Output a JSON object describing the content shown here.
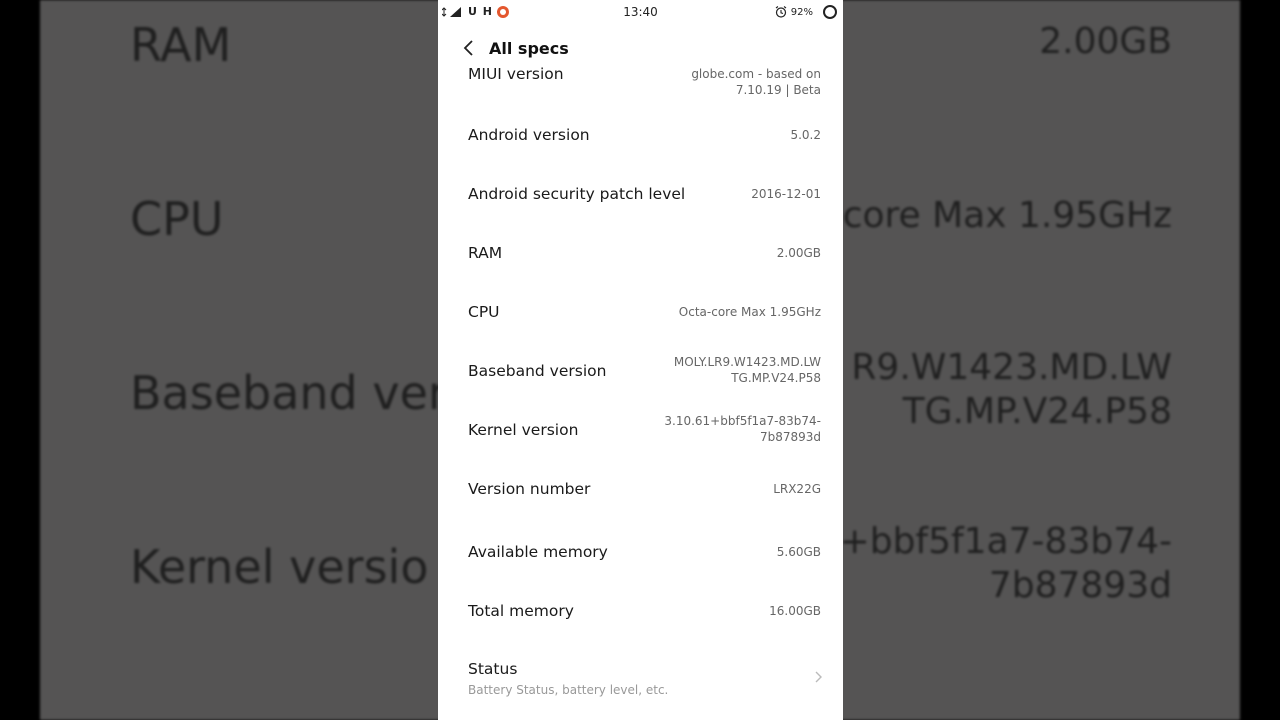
{
  "background": {
    "left_labels": [
      "RAM",
      "CPU",
      "Baseband ver",
      "Kernel versio"
    ],
    "right_values": [
      [
        "2.00GB"
      ],
      [
        "core Max 1.95GHz"
      ],
      [
        "R9.W1423.MD.LW",
        "TG.MP.V24.P58"
      ],
      [
        "+bbf5f1a7-83b74-",
        "7b87893d"
      ]
    ]
  },
  "statusbar": {
    "network": "U H",
    "time": "13:40",
    "battery": "92%"
  },
  "header": {
    "title": "All specs"
  },
  "rows": [
    {
      "label": "MIUI version",
      "value": [
        "globe.com - based on",
        "7.10.19 | Beta"
      ]
    },
    {
      "label": "Android version",
      "value": [
        "5.0.2"
      ]
    },
    {
      "label": "Android security patch level",
      "value": [
        "2016-12-01"
      ]
    },
    {
      "label": "RAM",
      "value": [
        "2.00GB"
      ]
    },
    {
      "label": "CPU",
      "value": [
        "Octa-core Max 1.95GHz"
      ]
    },
    {
      "label": "Baseband version",
      "value": [
        "MOLY.LR9.W1423.MD.LW",
        "TG.MP.V24.P58"
      ]
    },
    {
      "label": "Kernel version",
      "value": [
        "3.10.61+bbf5f1a7-83b74-",
        "7b87893d"
      ]
    },
    {
      "label": "Version number",
      "value": [
        "LRX22G"
      ]
    },
    {
      "label": "Available memory",
      "value": [
        "5.60GB"
      ]
    },
    {
      "label": "Total memory",
      "value": [
        "16.00GB"
      ]
    }
  ],
  "status_row": {
    "label": "Status",
    "subtitle": "Battery Status, battery level, etc."
  }
}
